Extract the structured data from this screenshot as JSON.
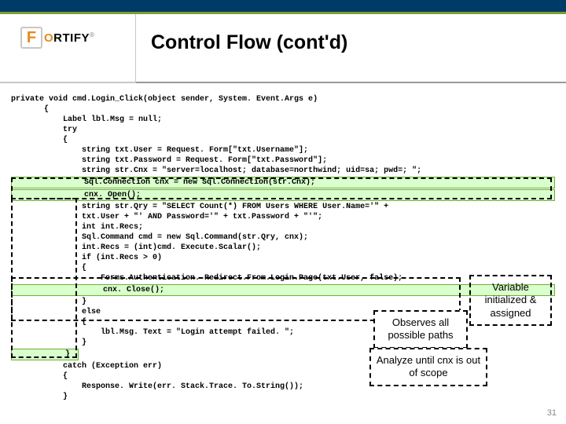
{
  "header": {
    "logo_text_html": "ORTIFY",
    "title": "Control Flow (cont'd)"
  },
  "code": {
    "l1": "private void cmd.Login_Click(object sender, System. Event.Args e)",
    "l2": "       {",
    "l3": "           Label lbl.Msg = null;",
    "l4": "           try",
    "l5": "           {",
    "l6": "               string txt.User = Request. Form[\"txt.Username\"];",
    "l7": "               string txt.Password = Request. Form[\"txt.Password\"];",
    "l8": "               string str.Cnx = \"server=localhost; database=northwind; uid=sa; pwd=; \";",
    "l9": "               Sql.Connection cnx = new Sql.Connection(str.Cnx);",
    "l10": "               cnx. Open();",
    "l11": "",
    "l12": "               string str.Qry = \"SELECT Count(*) FROM Users WHERE User.Name='\" +",
    "l13": "               txt.User + \"' AND Password='\" + txt.Password + \"'\";",
    "l14": "               int int.Recs;",
    "l15": "",
    "l16": "               Sql.Command cmd = new Sql.Command(str.Qry, cnx);",
    "l17": "               int.Recs = (int)cmd. Execute.Scalar();",
    "l18": "",
    "l19": "               if (int.Recs > 0)",
    "l20": "               {",
    "l21": "                   Forms.Authentication. Redirect.From.Login.Page(txt.User, false);",
    "l22": "                   cnx. Close();",
    "l23": "               }",
    "l24": "               else",
    "l25": "               {",
    "l26": "                   lbl.Msg. Text = \"Login attempt failed. \";",
    "l27": "               }",
    "l28": "           }",
    "l29": "           catch (Exception err)",
    "l30": "           {",
    "l31": "               Response. Write(err. Stack.Trace. To.String());",
    "l32": "           }"
  },
  "annotations": {
    "variable": "Variable initialized & assigned",
    "observes": "Observes all possible paths",
    "scope": "Analyze until cnx is out of scope"
  },
  "page_number": "31"
}
